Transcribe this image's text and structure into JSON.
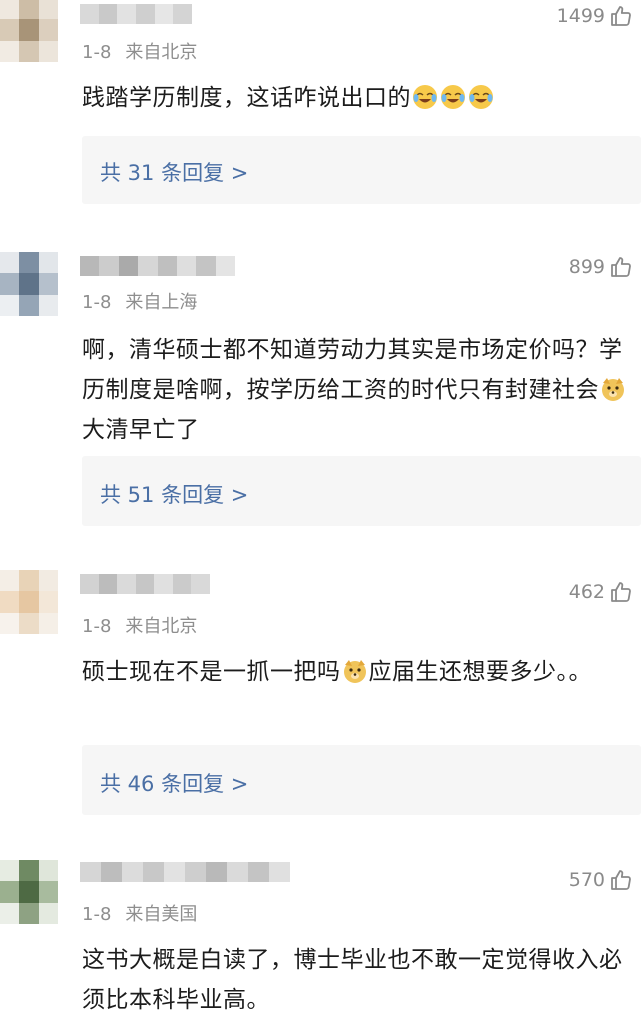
{
  "comments": [
    {
      "date": "1-8",
      "location": "来自北京",
      "likes": "1499",
      "text_parts": [
        "践踏学历制度，这话咋说出口的"
      ],
      "emojis": [
        "laugh-cry-emoji",
        "laugh-cry-emoji",
        "laugh-cry-emoji"
      ],
      "replies": "共 31 条回复 >"
    },
    {
      "date": "1-8",
      "location": "来自上海",
      "likes": "899",
      "text_parts": [
        "啊，清华硕士都不知道劳动力其实是市场定价吗？学历制度是啥啊，按学历给工资的时代只有封建社会",
        "大清早亡了"
      ],
      "emojis": [
        "doge-emoji"
      ],
      "replies": "共 51 条回复 >"
    },
    {
      "date": "1-8",
      "location": "来自北京",
      "likes": "462",
      "text_parts": [
        "硕士现在不是一抓一把吗",
        "应届生还想要多少。。"
      ],
      "emojis": [
        "doge-emoji"
      ],
      "replies": "共 46 条回复 >"
    },
    {
      "date": "1-8",
      "location": "来自美国",
      "likes": "570",
      "text_parts": [
        "这书大概是白读了，博士毕业也不敢一定觉得收入必须比本科毕业高。"
      ],
      "emojis": [],
      "replies": ""
    }
  ],
  "colors": {
    "likes_text": "#8a8a8a",
    "meta_text": "#8e8e8e",
    "reply_link": "#4a6fa5",
    "reply_box_bg": "#f6f6f6"
  }
}
